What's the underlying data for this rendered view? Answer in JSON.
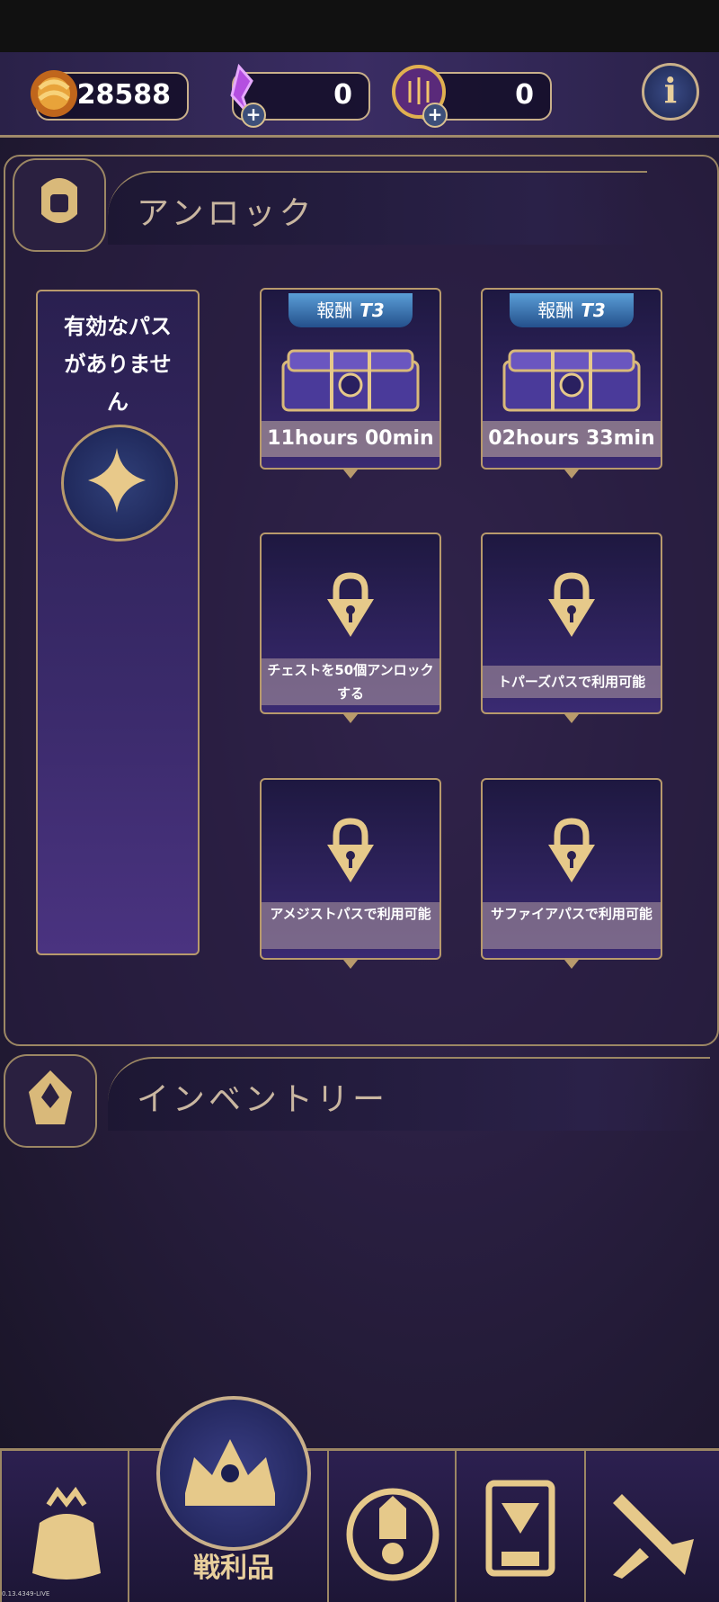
{
  "colors": {
    "gold": "#c9b08a",
    "panel": "#2a2148",
    "reward_tag": "#3a78c0",
    "accent_purple": "#3a2a72"
  },
  "top_bar": {
    "gold_amount": "28588",
    "gem_amount": "0",
    "token_amount": "0",
    "info_icon": "i"
  },
  "unlock_section": {
    "title": "アンロック",
    "no_pass_text": "有効なパスがありません",
    "chests": [
      {
        "reward_label": "報酬",
        "tier": "T3",
        "timer": "11hours 00min"
      },
      {
        "reward_label": "報酬",
        "tier": "T3",
        "timer": "02hours 33min"
      }
    ],
    "locked_slots": [
      {
        "text": "チェストを50個アンロックする"
      },
      {
        "text": "トパーズパスで利用可能"
      },
      {
        "text": "アメジストパスで利用可能"
      },
      {
        "text": "サファイアパスで利用可能"
      }
    ]
  },
  "inventory_section": {
    "title": "インベントリー"
  },
  "bottom_nav": {
    "active_label": "戦利品",
    "items": [
      "loot-bag-icon",
      "crown-icon",
      "champion-icon",
      "card-icon",
      "battle-icon"
    ]
  },
  "version": "0.13.4349-LIVE"
}
